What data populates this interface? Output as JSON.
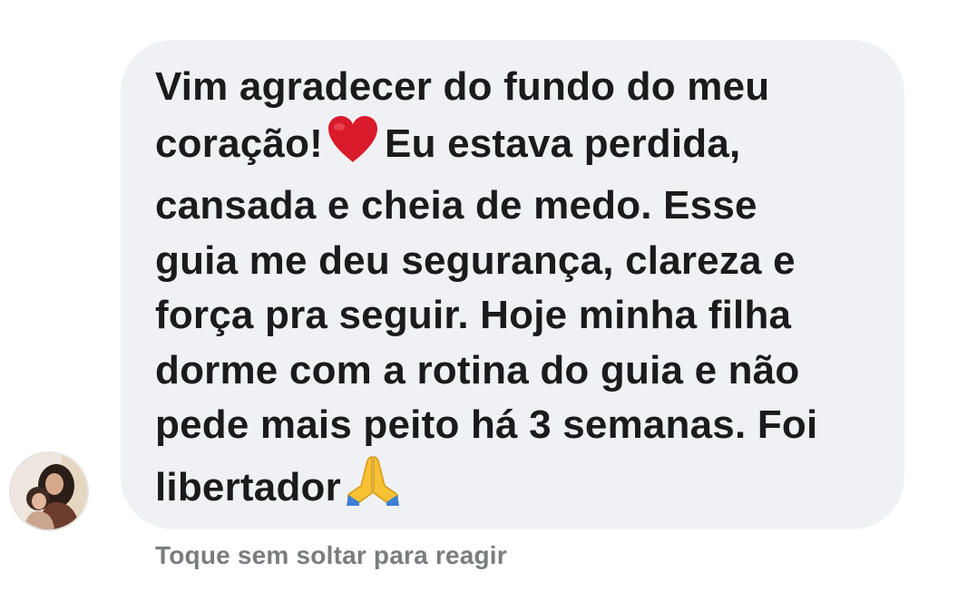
{
  "message": {
    "lines": [
      "Vim agradecer do fundo do meu",
      "coração!",
      "Eu estava perdida,",
      "cansada e cheia de medo. Esse",
      "guia me deu segurança, clareza e",
      "força pra seguir. Hoje minha filha",
      "dorme com a rotina do guia e não",
      "pede mais peito há 3 semanas. Foi",
      "libertador"
    ],
    "emojis": [
      "red-heart-icon",
      "folded-hands-icon"
    ]
  },
  "reaction_hint": "Toque sem soltar para reagir",
  "colors": {
    "bubble": "#f0f1f4",
    "text": "#1b1b1d",
    "hint": "#7a7c80",
    "heart": "#d91a2a",
    "hands": "#f7c133"
  }
}
